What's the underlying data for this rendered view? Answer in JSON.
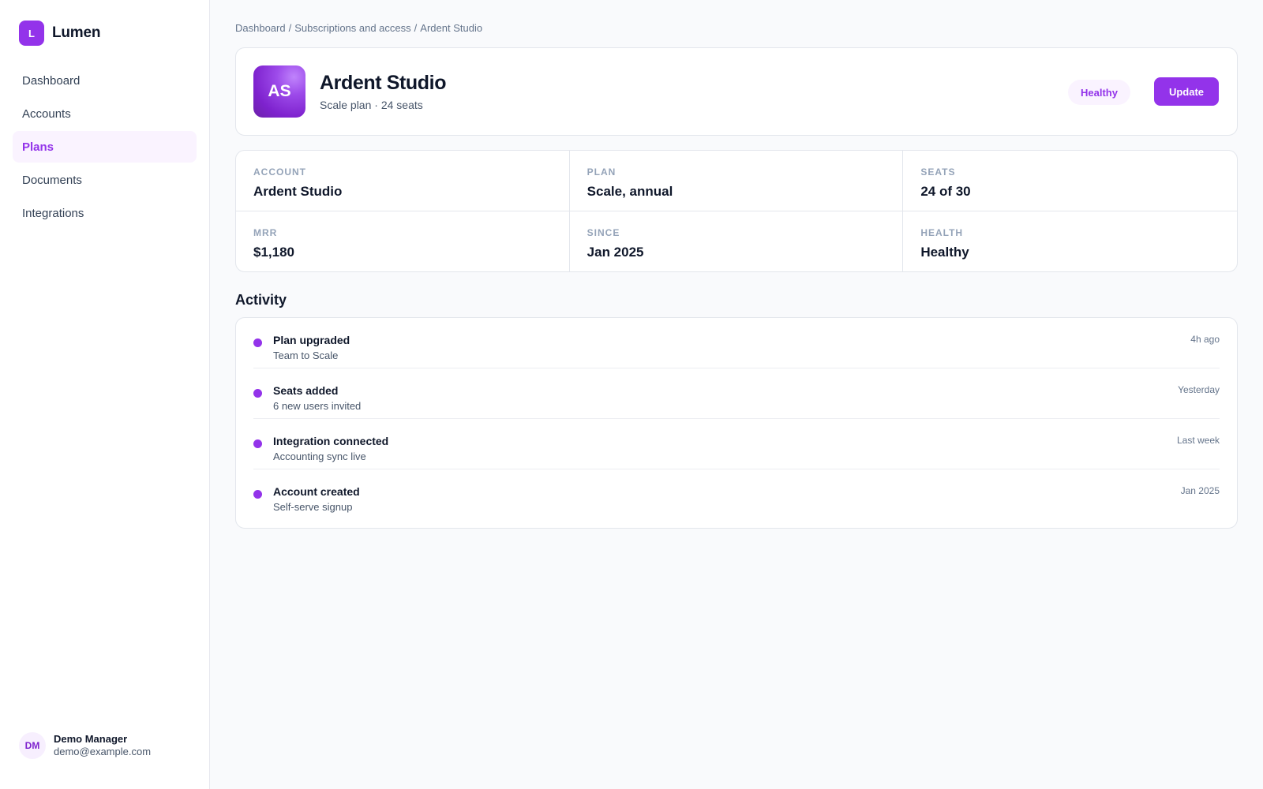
{
  "brand": {
    "logo_letter": "L",
    "name": "Lumen"
  },
  "nav": {
    "items": [
      {
        "label": "Dashboard",
        "active": false
      },
      {
        "label": "Accounts",
        "active": false
      },
      {
        "label": "Plans",
        "active": true
      },
      {
        "label": "Documents",
        "active": false
      },
      {
        "label": "Integrations",
        "active": false
      }
    ]
  },
  "user": {
    "initials": "DM",
    "name": "Demo Manager",
    "email": "demo@example.com"
  },
  "breadcrumb": [
    "Dashboard",
    "Subscriptions and access",
    "Ardent Studio"
  ],
  "header": {
    "avatar_initials": "AS",
    "title": "Ardent Studio",
    "subtitle": "Scale plan · 24 seats",
    "status_badge": "Healthy",
    "update_label": "Update"
  },
  "stats": [
    {
      "label": "Account",
      "value": "Ardent Studio"
    },
    {
      "label": "Plan",
      "value": "Scale, annual"
    },
    {
      "label": "Seats",
      "value": "24 of 30"
    },
    {
      "label": "MRR",
      "value": "$1,180"
    },
    {
      "label": "Since",
      "value": "Jan 2025"
    },
    {
      "label": "Health",
      "value": "Healthy"
    }
  ],
  "activity": {
    "title": "Activity",
    "items": [
      {
        "title": "Plan upgraded",
        "detail": "Team to Scale",
        "time": "4h ago"
      },
      {
        "title": "Seats added",
        "detail": "6 new users invited",
        "time": "Yesterday"
      },
      {
        "title": "Integration connected",
        "detail": "Accounting sync live",
        "time": "Last week"
      },
      {
        "title": "Account created",
        "detail": "Self-serve signup",
        "time": "Jan 2025"
      }
    ]
  },
  "colors": {
    "accent": "#9333ea",
    "accent_soft": "#faf3ff",
    "text": "#0f172a",
    "muted": "#64748b"
  }
}
